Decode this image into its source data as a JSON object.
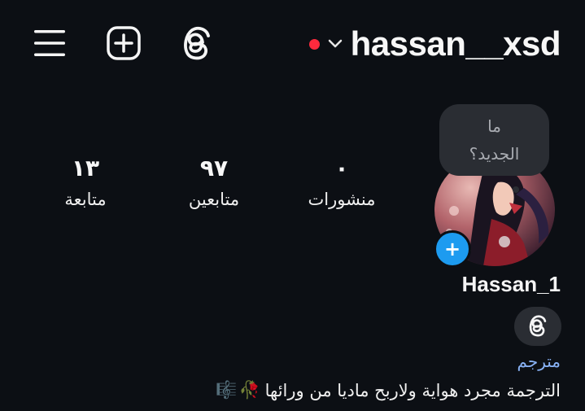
{
  "header": {
    "username": "hassan__xsd",
    "live_dot_color": "#ff2a3d",
    "icons": [
      "menu-icon",
      "create-icon",
      "threads-icon",
      "chevron-down-icon"
    ]
  },
  "note": {
    "line1": "ما",
    "line2": "الجديد؟"
  },
  "stats": {
    "posts": {
      "value": "٠",
      "label": "منشورات"
    },
    "followers": {
      "value": "٩٧",
      "label": "متابعين"
    },
    "following": {
      "value": "١٣",
      "label": "متابعة"
    }
  },
  "profile": {
    "display_name": "Hassan_1",
    "add_story_glyph": "+",
    "category": "مترجم",
    "bio": "الترجمة مجرد هواية ولاربح ماديا من ورائها",
    "bio_emojis": [
      "🎼",
      "🥀"
    ]
  },
  "colors": {
    "background": "#0c0f14",
    "accent_blue": "#1d9bf0",
    "category_blue": "#8ab4f8",
    "bubble": "#2a2d33"
  }
}
